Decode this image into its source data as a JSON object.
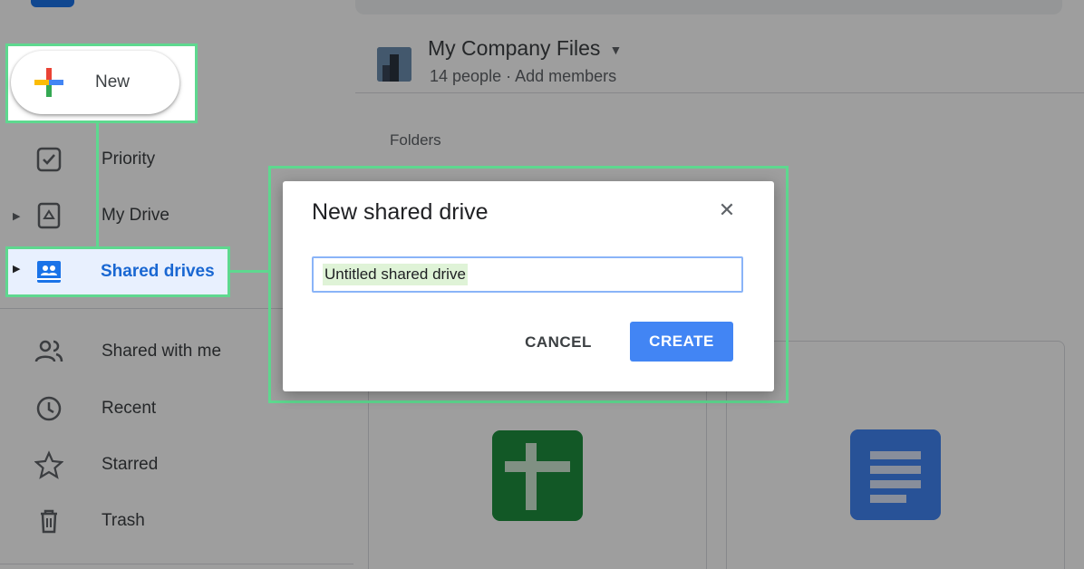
{
  "sidebar": {
    "new_label": "New",
    "items": [
      {
        "label": "Priority",
        "icon": "priority-checkbox-icon"
      },
      {
        "label": "My Drive",
        "icon": "my-drive-icon"
      },
      {
        "label": "Shared drives",
        "icon": "shared-drives-icon",
        "active": true
      },
      {
        "label": "Shared with me",
        "icon": "people-icon"
      },
      {
        "label": "Recent",
        "icon": "clock-icon"
      },
      {
        "label": "Starred",
        "icon": "star-icon"
      },
      {
        "label": "Trash",
        "icon": "trash-icon"
      }
    ]
  },
  "main": {
    "drive_name": "My Company Files",
    "people_count": "14 people",
    "separator": "·",
    "add_members": "Add members",
    "folders_label": "Folders"
  },
  "dialog": {
    "title": "New shared drive",
    "input_value": "Untitled shared drive",
    "cancel_label": "CANCEL",
    "create_label": "CREATE",
    "close_icon": "close-icon"
  },
  "colors": {
    "highlight": "#5ed88f",
    "accent": "#4285f4",
    "active_nav": "#1967d2"
  }
}
